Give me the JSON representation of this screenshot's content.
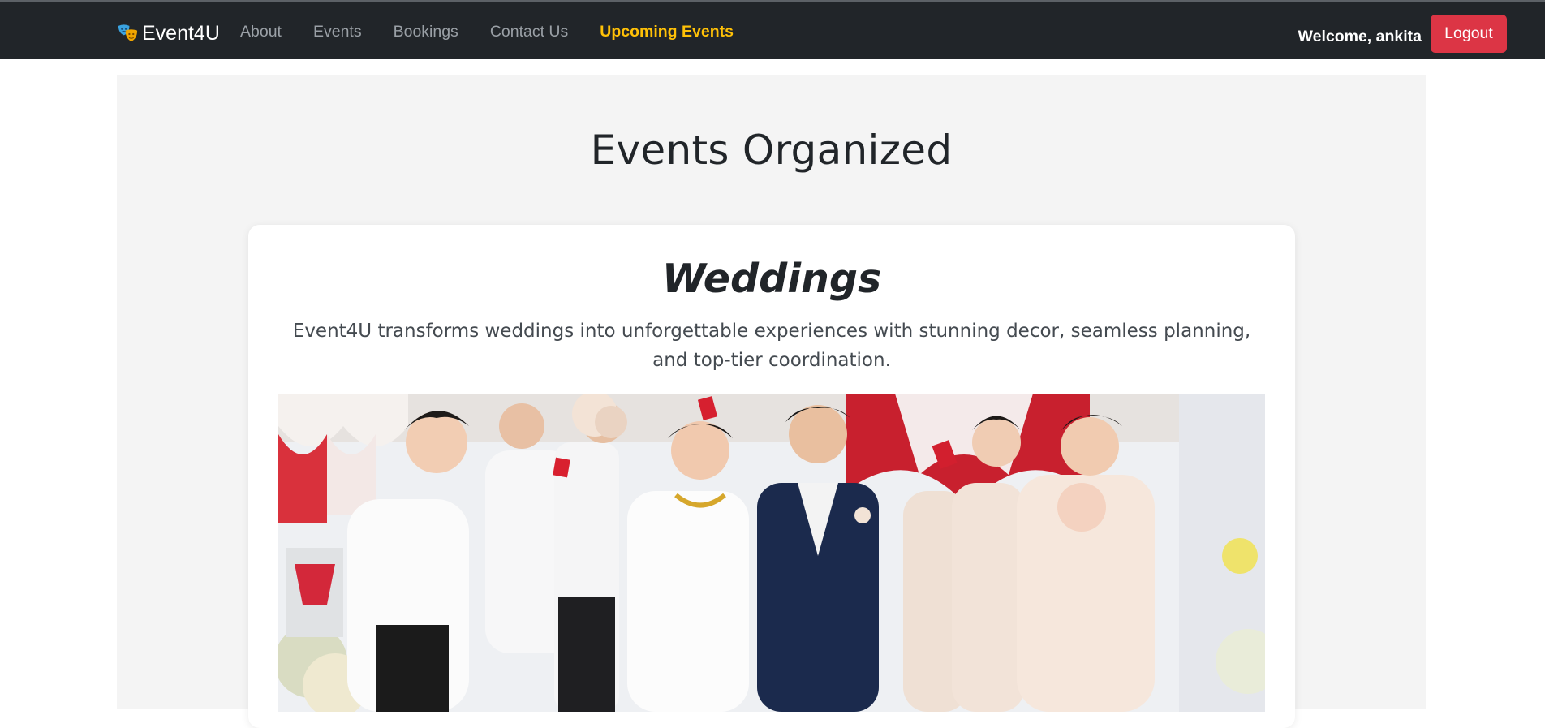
{
  "navbar": {
    "brand": "Event4U",
    "brand_icon": "theater-masks-icon",
    "links": [
      {
        "label": "About"
      },
      {
        "label": "Events"
      },
      {
        "label": "Bookings"
      },
      {
        "label": "Contact Us"
      },
      {
        "label": "Upcoming Events",
        "active": true
      }
    ],
    "welcome": "Welcome, ankita",
    "logout_label": "Logout"
  },
  "main": {
    "title": "Events Organized",
    "cards": [
      {
        "title": "Weddings",
        "description": "Event4U transforms weddings into unforgettable experiences with stunning decor, seamless planning, and top-tier coordination.",
        "image": "wedding-photo"
      }
    ]
  },
  "colors": {
    "navbar_bg": "#212529",
    "accent_active": "#ffc107",
    "logout_bg": "#dc3545",
    "content_bg": "#f4f4f4"
  }
}
